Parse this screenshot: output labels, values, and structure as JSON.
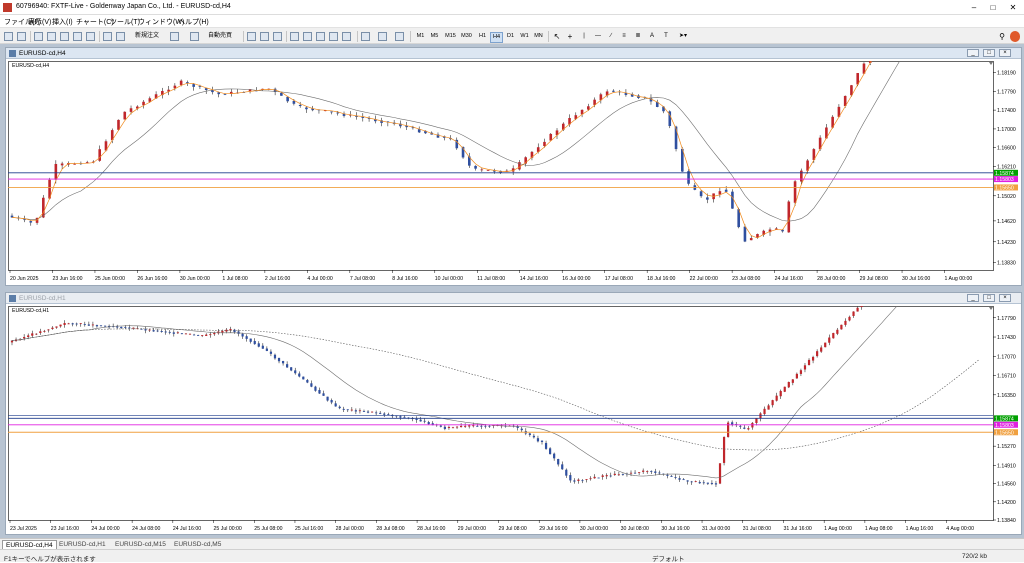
{
  "app": {
    "title": "60796940: FXTF-Live - Goldenway Japan Co., Ltd. - EURUSD-cd,H4"
  },
  "menu": [
    "ファイル(F)",
    "表示(V)",
    "挿入(I)",
    "チャート(C)",
    "ツール(T)",
    "ウィンドウ(W)",
    "ヘルプ(H)"
  ],
  "toolbar": {
    "new_order": "新規注文",
    "auto_trade": "自動売買",
    "timeframes": [
      "M1",
      "M5",
      "M15",
      "M30",
      "H1",
      "H4",
      "D1",
      "W1",
      "MN"
    ],
    "active_timeframe": "H4"
  },
  "charts": [
    {
      "window_title": "EURUSD-cd,H4",
      "label": "EURUSD-cd,H4",
      "price_labels": [
        "1.18190",
        "1.17790",
        "1.17400",
        "1.17000",
        "1.16600",
        "1.16210",
        "1.15020",
        "1.14620",
        "1.14230",
        "1.13830"
      ],
      "time_labels": [
        "20 Jun 2025",
        "23 Jun 16:00",
        "25 Jun 00:00",
        "26 Jun 16:00",
        "30 Jun 00:00",
        "1 Jul 08:00",
        "2 Jul 16:00",
        "4 Jul 00:00",
        "7 Jul 08:00",
        "8 Jul 16:00",
        "10 Jul 00:00",
        "11 Jul 08:00",
        "14 Jul 16:00",
        "16 Jul 00:00",
        "17 Jul 08:00",
        "18 Jul 16:00",
        "22 Jul 00:00",
        "23 Jul 08:00",
        "24 Jul 16:00",
        "28 Jul 00:00",
        "29 Jul 08:00",
        "30 Jul 16:00",
        "1 Aug 00:00"
      ],
      "level_tags": {
        "bid": "1.15874",
        "magenta": "1.15803",
        "orange": "1.15650"
      }
    },
    {
      "window_title": "EURUSD-cd,H1",
      "label": "EURUSD-cd,H1",
      "price_labels": [
        "1.17790",
        "1.17430",
        "1.17070",
        "1.16710",
        "1.16350",
        "1.15270",
        "1.14910",
        "1.14560",
        "1.14200",
        "1.13840"
      ],
      "time_labels": [
        "23 Jul 2025",
        "23 Jul 16:00",
        "24 Jul 00:00",
        "24 Jul 08:00",
        "24 Jul 16:00",
        "25 Jul 00:00",
        "25 Jul 08:00",
        "25 Jul 16:00",
        "28 Jul 00:00",
        "28 Jul 08:00",
        "28 Jul 16:00",
        "29 Jul 00:00",
        "29 Jul 08:00",
        "29 Jul 16:00",
        "30 Jul 00:00",
        "30 Jul 08:00",
        "30 Jul 16:00",
        "31 Jul 00:00",
        "31 Jul 08:00",
        "31 Jul 16:00",
        "1 Aug 00:00",
        "1 Aug 08:00",
        "1 Aug 16:00",
        "4 Aug 00:00"
      ],
      "level_tags": {
        "bid": "1.15874",
        "magenta": "1.15803",
        "orange": "1.15650"
      }
    }
  ],
  "tabs": [
    "EURUSD-cd,H4",
    "EURUSD-cd,H1",
    "EURUSD-cd,M15",
    "EURUSD-cd,M5"
  ],
  "active_tab": "EURUSD-cd,H4",
  "status": {
    "help": "F1キーでヘルプが表示されます",
    "profile": "デフォルト",
    "traffic": "720/2 kb"
  },
  "colors": {
    "bull": "#c0262b",
    "bear": "#2f4f9f",
    "ma_gray": "#6e6e6e",
    "ma_orange": "#f08a1c",
    "level_blue": "#1e3c8c",
    "level_magenta": "#e020e0",
    "level_orange": "#f0a040",
    "tag_green": "#00a000"
  }
}
